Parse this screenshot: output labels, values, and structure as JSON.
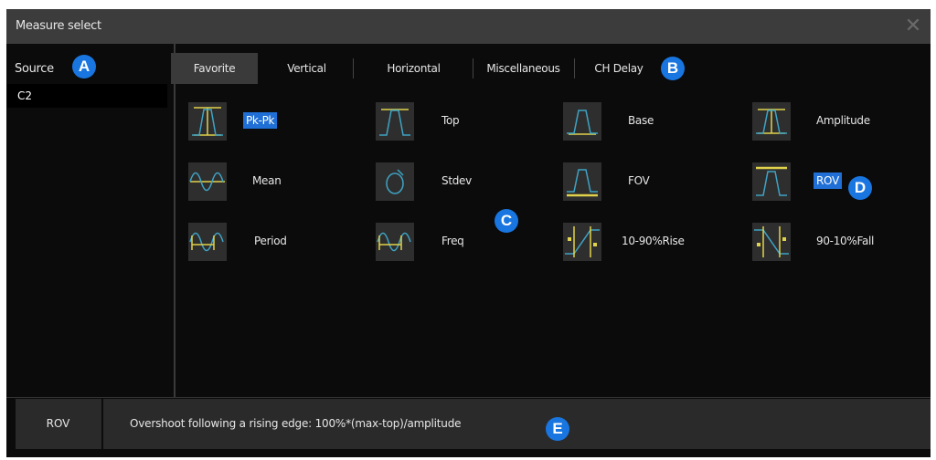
{
  "dialog": {
    "title": "Measure select",
    "close_glyph": "✕"
  },
  "source": {
    "label": "Source",
    "items": [
      "C2"
    ]
  },
  "tabs": [
    {
      "label": "Favorite",
      "active": true
    },
    {
      "label": "Vertical",
      "active": false
    },
    {
      "label": "Horizontal",
      "active": false
    },
    {
      "label": "Miscellaneous",
      "active": false
    },
    {
      "label": "CH Delay",
      "active": false
    }
  ],
  "measurements": [
    {
      "label": "Pk-Pk",
      "icon": "pk-pk-icon",
      "selected": true
    },
    {
      "label": "Top",
      "icon": "top-icon",
      "selected": false
    },
    {
      "label": "Base",
      "icon": "base-icon",
      "selected": false
    },
    {
      "label": "Amplitude",
      "icon": "amplitude-icon",
      "selected": false
    },
    {
      "label": "Mean",
      "icon": "mean-icon",
      "selected": false
    },
    {
      "label": "Stdev",
      "icon": "stdev-icon",
      "selected": false
    },
    {
      "label": "FOV",
      "icon": "fov-icon",
      "selected": false
    },
    {
      "label": "ROV",
      "icon": "rov-icon",
      "selected": true
    },
    {
      "label": "Period",
      "icon": "period-icon",
      "selected": false
    },
    {
      "label": "Freq",
      "icon": "freq-icon",
      "selected": false
    },
    {
      "label": "10-90%Rise",
      "icon": "rise-icon",
      "selected": false
    },
    {
      "label": "90-10%Fall",
      "icon": "fall-icon",
      "selected": false
    }
  ],
  "callouts": {
    "a": "A",
    "b": "B",
    "c": "C",
    "d": "D",
    "e": "E"
  },
  "footer": {
    "selected_name": "ROV",
    "description": "Overshoot following a rising edge: 100%*(max-top)/amplitude"
  },
  "colors": {
    "accent": "#1f6fd6",
    "badge": "#1976e0",
    "waveform": "#3fa3c4",
    "marker": "#e0d24a"
  }
}
